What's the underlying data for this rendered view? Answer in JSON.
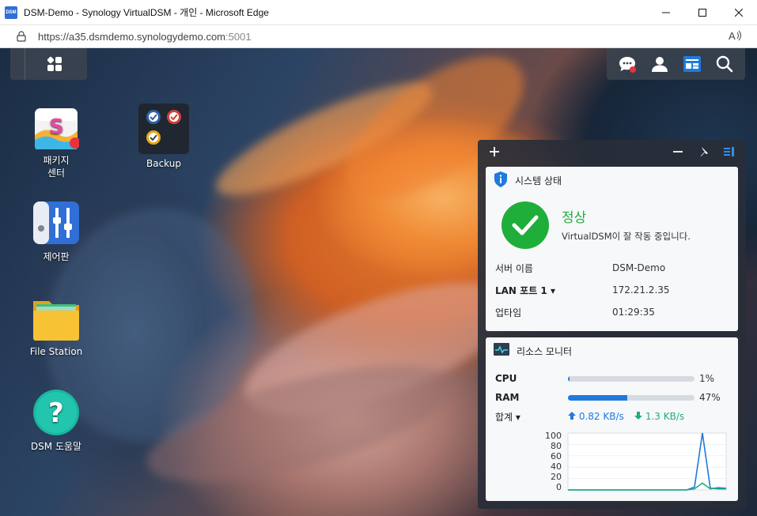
{
  "browser": {
    "app_icon_text": "DSM",
    "title": "DSM-Demo - Synology VirtualDSM - 개인 - Microsoft Edge",
    "url_main": "https://a35.dsmdemo.synologydemo.com",
    "url_port": ":5001",
    "reader_label": "A̅³"
  },
  "desktop_icons": [
    {
      "label": "패키지\n센터"
    },
    {
      "label": "Backup"
    },
    {
      "label": "제어판"
    },
    {
      "label": "File Station"
    },
    {
      "label": "DSM 도움말"
    }
  ],
  "widget_system": {
    "title": "시스템 상태",
    "status": "정상",
    "status_message": "VirtualDSM이 잘 작동 중입니다.",
    "rows": [
      {
        "key": "서버 이름",
        "value": "DSM-Demo"
      },
      {
        "key": "LAN 포트 1 ▾",
        "value": "172.21.2.35"
      },
      {
        "key": "업타임",
        "value": "01:29:35"
      }
    ]
  },
  "widget_resource": {
    "title": "리소스 모니터",
    "cpu_label": "CPU",
    "cpu_percent_text": "1%",
    "cpu_percent": 1,
    "ram_label": "RAM",
    "ram_percent_text": "47%",
    "ram_percent": 47,
    "total_label": "합계 ▾",
    "upload": "0.82 KB/s",
    "download": "1.3 KB/s",
    "y_ticks": [
      "100",
      "80",
      "60",
      "40",
      "20",
      "0"
    ]
  },
  "chart_data": {
    "type": "line",
    "title": "",
    "ylim": [
      0,
      100
    ],
    "x": [
      0,
      1,
      2,
      3,
      4,
      5,
      6,
      7,
      8,
      9,
      10,
      11,
      12,
      13,
      14,
      15,
      16,
      17,
      18,
      19,
      20
    ],
    "series": [
      {
        "values": [
          0,
          0,
          0,
          0,
          0,
          0,
          0,
          0,
          0,
          0,
          0,
          0,
          0,
          0,
          0,
          0,
          5,
          100,
          3,
          2,
          2
        ]
      },
      {
        "values": [
          0,
          0,
          0,
          0,
          0,
          0,
          0,
          0,
          0,
          0,
          0,
          0,
          0,
          0,
          0,
          0,
          2,
          12,
          2,
          4,
          3
        ]
      }
    ]
  },
  "colors": {
    "accent": "#1f7adb",
    "ok": "#1fae3a",
    "series_up": "#1f7adb",
    "series_down": "#1fae7a"
  }
}
